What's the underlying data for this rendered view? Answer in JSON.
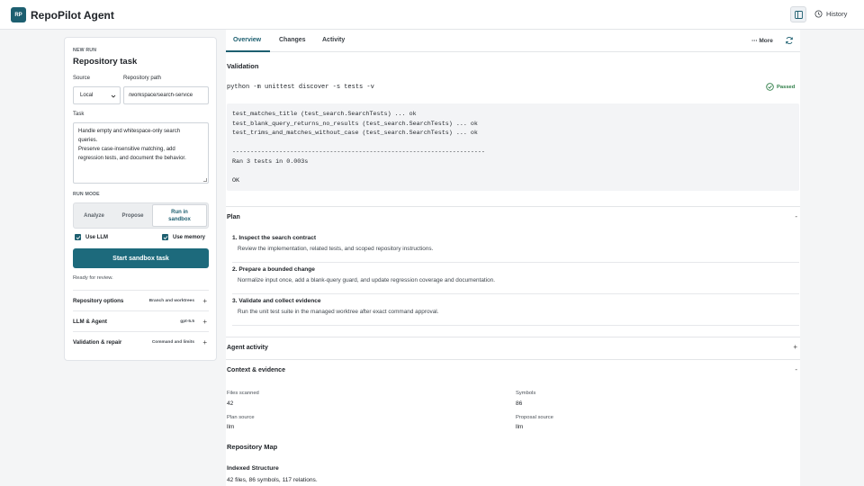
{
  "header": {
    "logo_text": "RP",
    "app_title": "RepoPilot Agent",
    "history_label": "History"
  },
  "left": {
    "eyebrow": "NEW RUN",
    "title": "Repository task",
    "source_label": "Source",
    "source_value": "Local",
    "path_label": "Repository path",
    "path_value": "/workspace/search-service",
    "task_label": "Task",
    "task_lines": [
      "Handle empty and whitespace-only search",
      "queries.",
      "Preserve case-insensitive matching, add",
      "regression tests, and document the behavior."
    ],
    "run_mode_label": "RUN MODE",
    "modes": [
      "Analyze",
      "Propose",
      "Run in sandbox"
    ],
    "use_llm": "Use LLM",
    "use_memory": "Use memory",
    "start_button": "Start sandbox task",
    "status": "Ready for review.",
    "accordions": [
      {
        "title": "Repository options",
        "meta": "Branch and worktrees"
      },
      {
        "title": "LLM & Agent",
        "meta": "gpt-5.5"
      },
      {
        "title": "Validation & repair",
        "meta": "Command and limits"
      }
    ]
  },
  "tabs": [
    "Overview",
    "Changes",
    "Activity"
  ],
  "more_label": "More",
  "validation": {
    "title": "Validation",
    "command": "python -m unittest discover -s tests -v",
    "status": "Passed",
    "output": "test_matches_title (test_search.SearchTests) ... ok\ntest_blank_query_returns_no_results (test_search.SearchTests) ... ok\ntest_trims_and_matches_without_case (test_search.SearchTests) ... ok\n\n----------------------------------------------------------------------\nRan 3 tests in 0.003s\n\nOK"
  },
  "plan": {
    "title": "Plan",
    "toggle": "-",
    "items": [
      {
        "title": "1. Inspect the search contract",
        "desc": "Review the implementation, related tests, and scoped repository instructions."
      },
      {
        "title": "2. Prepare a bounded change",
        "desc": "Normalize input once, add a blank-query guard, and update regression coverage and documentation."
      },
      {
        "title": "3. Validate and collect evidence",
        "desc": "Run the unit test suite in the managed worktree after exact command approval."
      }
    ]
  },
  "agent_activity": {
    "title": "Agent activity",
    "toggle": "+"
  },
  "context": {
    "title": "Context & evidence",
    "toggle": "-",
    "files_label": "Files scanned",
    "files_value": "42",
    "symbols_label": "Symbols",
    "symbols_value": "86",
    "plan_source_label": "Plan source",
    "plan_source_value": "llm",
    "proposal_source_label": "Proposal source",
    "proposal_source_value": "llm"
  },
  "repo_map": {
    "title": "Repository Map",
    "subtitle": "Indexed Structure",
    "summary": "42 files, 86 symbols, 117 relations."
  },
  "colors": {
    "accent": "#1d5f70",
    "button": "#1d6a7c",
    "success": "#2e7d47"
  }
}
